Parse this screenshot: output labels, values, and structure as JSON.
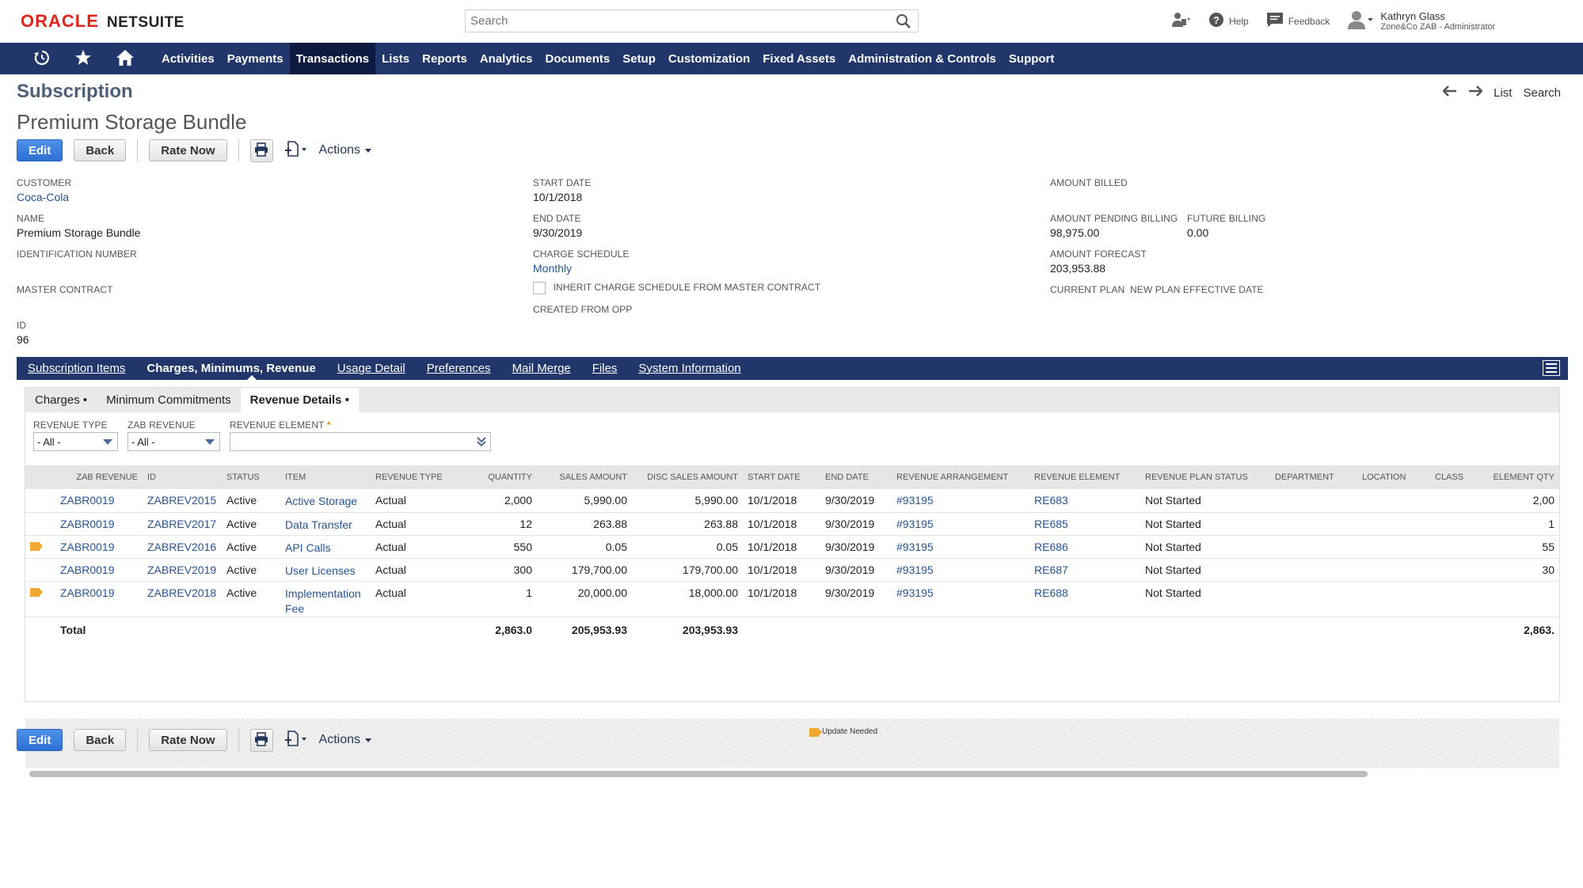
{
  "header": {
    "logo_oracle": "ORACLE",
    "logo_netsuite": "NETSUITE",
    "search_placeholder": "Search",
    "help": "Help",
    "feedback": "Feedback",
    "user_name": "Kathryn Glass",
    "user_role": "Zone&Co ZAB - Administrator"
  },
  "nav": {
    "items": [
      "Activities",
      "Payments",
      "Transactions",
      "Lists",
      "Reports",
      "Analytics",
      "Documents",
      "Setup",
      "Customization",
      "Fixed Assets",
      "Administration & Controls",
      "Support"
    ],
    "active": "Transactions"
  },
  "page": {
    "record_type": "Subscription",
    "title": "Premium Storage Bundle",
    "pager_list": "List",
    "pager_search": "Search"
  },
  "buttons": {
    "edit": "Edit",
    "back": "Back",
    "rate_now": "Rate Now",
    "actions": "Actions"
  },
  "fields": {
    "customer_label": "CUSTOMER",
    "customer": "Coca-Cola",
    "name_label": "NAME",
    "name": "Premium Storage Bundle",
    "identification_label": "IDENTIFICATION NUMBER",
    "master_contract_label": "MASTER CONTRACT",
    "id_label": "ID",
    "id": "96",
    "start_date_label": "START DATE",
    "start_date": "10/1/2018",
    "end_date_label": "END DATE",
    "end_date": "9/30/2019",
    "charge_schedule_label": "CHARGE SCHEDULE",
    "charge_schedule": "Monthly",
    "inherit_label": "INHERIT CHARGE SCHEDULE FROM MASTER CONTRACT",
    "created_from_label": "CREATED FROM OPP",
    "amount_billed_label": "AMOUNT BILLED",
    "amount_pending_label": "AMOUNT PENDING BILLING",
    "amount_pending": "98,975.00",
    "future_billing_label": "FUTURE BILLING",
    "future_billing": "0.00",
    "amount_forecast_label": "AMOUNT FORECAST",
    "amount_forecast": "203,953.88",
    "current_plan_label": "CURRENT PLAN",
    "new_plan_label": "NEW PLAN EFFECTIVE DATE"
  },
  "tabs": [
    "Subscription Items",
    "Charges, Minimums, Revenue",
    "Usage Detail",
    "Preferences",
    "Mail Merge",
    "Files",
    "System Information"
  ],
  "subtabs": [
    "Charges",
    "Minimum Commitments",
    "Revenue Details"
  ],
  "filters": {
    "revenue_type_label": "REVENUE TYPE",
    "revenue_type": "- All -",
    "zab_revenue_label": "ZAB REVENUE",
    "zab_revenue": "- All -",
    "revenue_element_label": "REVENUE ELEMENT",
    "required": "*"
  },
  "table": {
    "columns": [
      "ZAB REVENUE",
      "ID",
      "STATUS",
      "ITEM",
      "REVENUE TYPE",
      "QUANTITY",
      "SALES AMOUNT",
      "DISC SALES AMOUNT",
      "START DATE",
      "END DATE",
      "REVENUE ARRANGEMENT",
      "REVENUE ELEMENT",
      "REVENUE PLAN STATUS",
      "DEPARTMENT",
      "LOCATION",
      "CLASS",
      "ELEMENT QTY"
    ],
    "rows": [
      {
        "flag": false,
        "zab": "ZABR0019",
        "id": "ZABREV2015",
        "status": "Active",
        "item": "Active Storage",
        "type": "Actual",
        "qty": "2,000",
        "sales": "5,990.00",
        "disc": "5,990.00",
        "start": "10/1/2018",
        "end": "9/30/2019",
        "arr": "#93195",
        "elem": "RE683",
        "plan": "Not Started",
        "eqty": "2,00"
      },
      {
        "flag": false,
        "zab": "ZABR0019",
        "id": "ZABREV2017",
        "status": "Active",
        "item": "Data Transfer",
        "type": "Actual",
        "qty": "12",
        "sales": "263.88",
        "disc": "263.88",
        "start": "10/1/2018",
        "end": "9/30/2019",
        "arr": "#93195",
        "elem": "RE685",
        "plan": "Not Started",
        "eqty": "1"
      },
      {
        "flag": true,
        "zab": "ZABR0019",
        "id": "ZABREV2016",
        "status": "Active",
        "item": "API Calls",
        "type": "Actual",
        "qty": "550",
        "sales": "0.05",
        "disc": "0.05",
        "start": "10/1/2018",
        "end": "9/30/2019",
        "arr": "#93195",
        "elem": "RE686",
        "plan": "Not Started",
        "eqty": "55"
      },
      {
        "flag": false,
        "zab": "ZABR0019",
        "id": "ZABREV2019",
        "status": "Active",
        "item": "User Licenses",
        "type": "Actual",
        "qty": "300",
        "sales": "179,700.00",
        "disc": "179,700.00",
        "start": "10/1/2018",
        "end": "9/30/2019",
        "arr": "#93195",
        "elem": "RE687",
        "plan": "Not Started",
        "eqty": "30"
      },
      {
        "flag": true,
        "zab": "ZABR0019",
        "id": "ZABREV2018",
        "status": "Active",
        "item": "Implementation Fee",
        "type": "Actual",
        "qty": "1",
        "sales": "20,000.00",
        "disc": "18,000.00",
        "start": "10/1/2018",
        "end": "9/30/2019",
        "arr": "#93195",
        "elem": "RE688",
        "plan": "Not Started",
        "eqty": ""
      }
    ],
    "total_label": "Total",
    "total_qty": "2,863.0",
    "total_sales": "205,953.93",
    "total_disc": "203,953.93",
    "total_eqty": "2,863.",
    "legend": "Update Needed"
  },
  "colors": {
    "nav_bg": "#21366b",
    "link": "#255599",
    "flag": "#f0a830",
    "brand_red": "#e2231a"
  }
}
